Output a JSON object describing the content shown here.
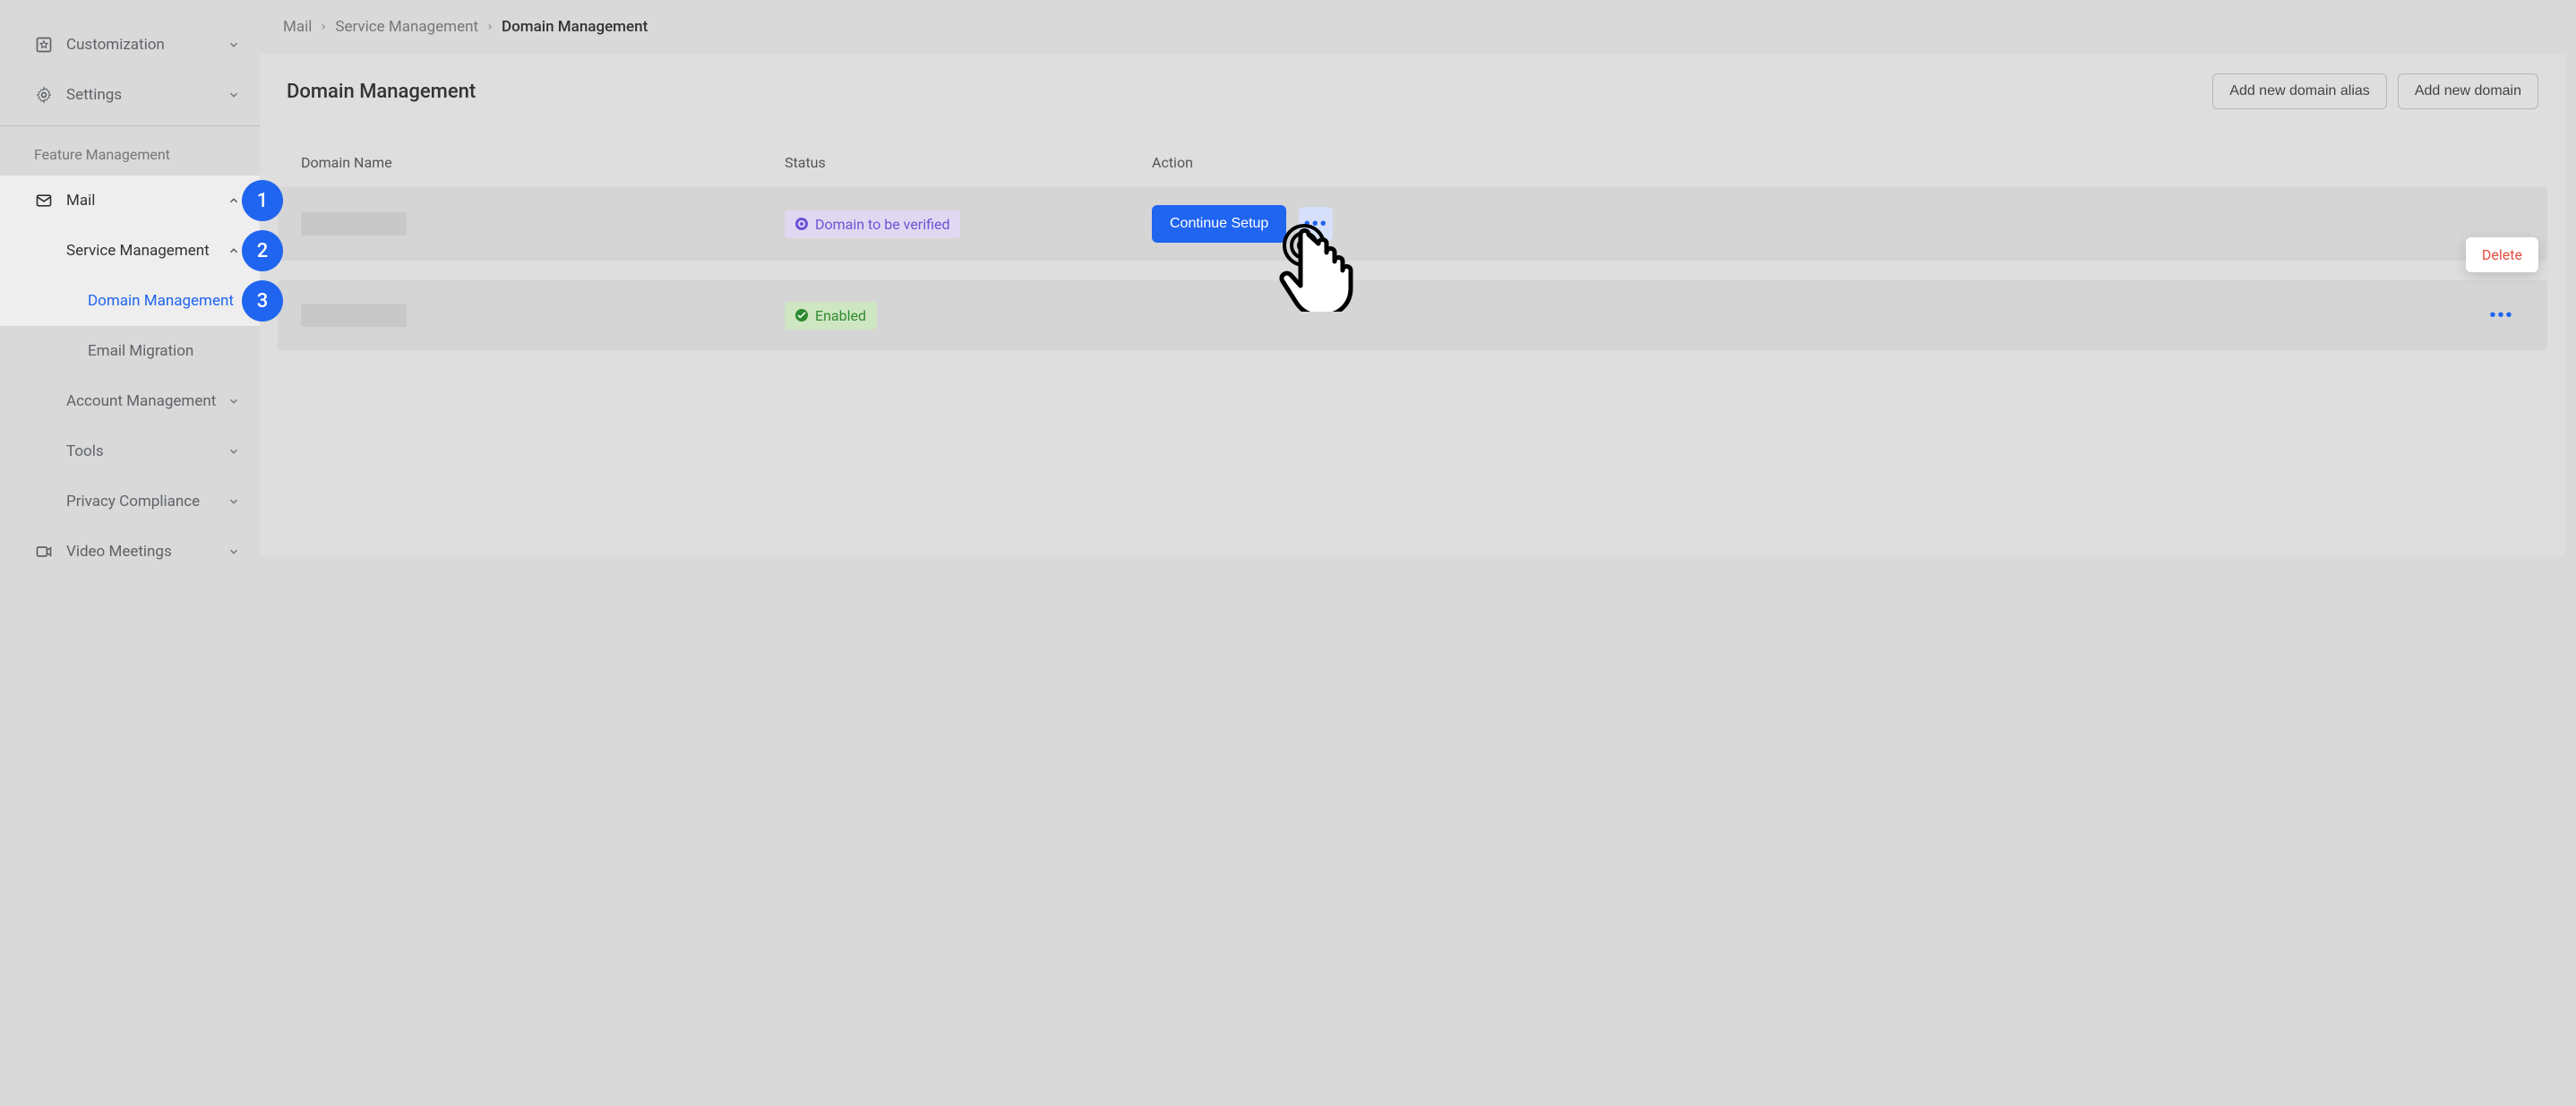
{
  "sidebar": {
    "top": {
      "customization": "Customization",
      "settings": "Settings"
    },
    "section_label": "Feature Management",
    "mail": "Mail",
    "service_mgmt": "Service Management",
    "domain_mgmt": "Domain Management",
    "email_migration": "Email Migration",
    "account_mgmt": "Account Management",
    "tools": "Tools",
    "privacy": "Privacy Compliance",
    "video_meetings": "Video Meetings"
  },
  "badges": {
    "b1": "1",
    "b2": "2",
    "b3": "3"
  },
  "breadcrumb": {
    "a": "Mail",
    "b": "Service Management",
    "c": "Domain Management"
  },
  "panel": {
    "title": "Domain Management",
    "add_alias": "Add new domain alias",
    "add_domain": "Add new domain"
  },
  "table": {
    "col_name": "Domain Name",
    "col_status": "Status",
    "col_action": "Action",
    "row1": {
      "status_label": "Domain to be verified",
      "continue": "Continue Setup"
    },
    "row2": {
      "status_label": "Enabled"
    }
  },
  "popover": {
    "delete": "Delete"
  }
}
